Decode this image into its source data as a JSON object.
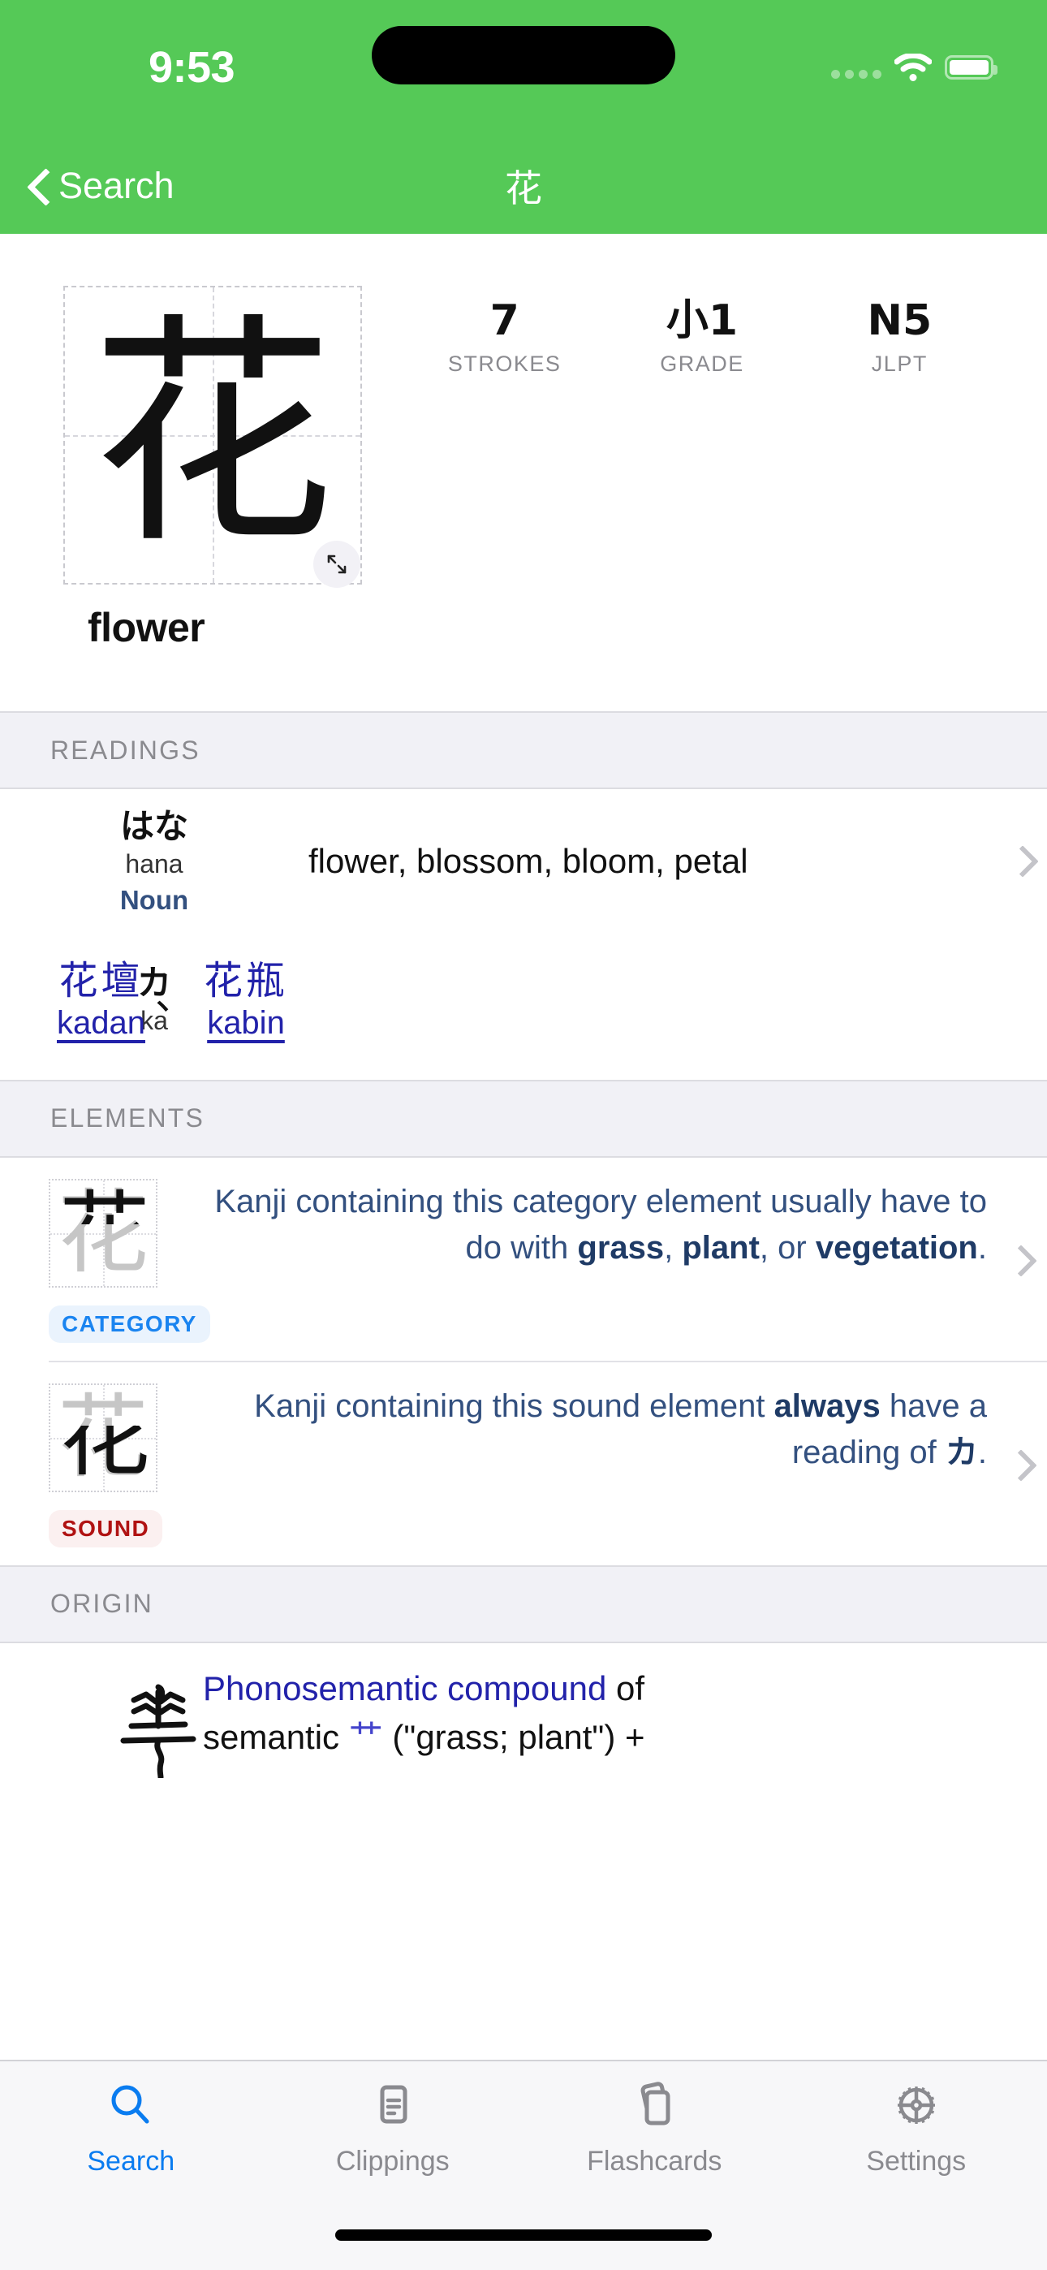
{
  "status_bar": {
    "time": "9:53",
    "icons": [
      "cellular-dots-icon",
      "wifi-icon",
      "battery-icon"
    ]
  },
  "nav": {
    "back_label": "Search",
    "back_icon": "chevron-left-icon",
    "title": "花"
  },
  "hero": {
    "kanji": "花",
    "meaning": "flower",
    "expand_icon": "expand-arrows-icon",
    "stats": [
      {
        "value": "7",
        "label": "STROKES"
      },
      {
        "value": "小1",
        "label": "GRADE"
      },
      {
        "value": "N5",
        "label": "JLPT"
      }
    ]
  },
  "readings": {
    "section_title": "READINGS",
    "rows": [
      {
        "kana": "はな",
        "romaji": "hana",
        "pos": "Noun",
        "gloss": "flower, blossom, bloom, petal",
        "chevron": "chevron-right-icon"
      },
      {
        "kana": "カ",
        "romaji": "ka",
        "separator": "、",
        "words": [
          {
            "jp": "花壇",
            "romaji": "kadan"
          },
          {
            "jp": "花瓶",
            "romaji": "kabin"
          }
        ]
      }
    ]
  },
  "elements": {
    "section_title": "ELEMENTS",
    "rows": [
      {
        "glyph": "花",
        "badge": "CATEGORY",
        "text_parts": [
          {
            "t": "Kanji containing this category element usually have to do with ",
            "bold": false
          },
          {
            "t": "grass",
            "bold": true
          },
          {
            "t": ", ",
            "bold": false
          },
          {
            "t": "plant",
            "bold": true
          },
          {
            "t": ", or ",
            "bold": false
          },
          {
            "t": "vegetation",
            "bold": true
          },
          {
            "t": ".",
            "bold": false
          }
        ],
        "chevron": "chevron-right-icon"
      },
      {
        "glyph": "花",
        "badge": "SOUND",
        "text_parts": [
          {
            "t": "Kanji containing this sound element ",
            "bold": false
          },
          {
            "t": "always",
            "bold": true
          },
          {
            "t": " have a reading of ",
            "bold": false
          },
          {
            "t": "カ",
            "bold": true
          },
          {
            "t": ".",
            "bold": false
          }
        ],
        "chevron": "chevron-right-icon"
      }
    ]
  },
  "origin": {
    "section_title": "ORIGIN",
    "seal_glyph": "seal-script-glyph-icon",
    "line1_link": "Phonosemantic compound",
    "line1_rest": " of",
    "line2_pre": "semantic ",
    "line2_kanji": "艹",
    "line2_post": " (\"grass; plant\") +"
  },
  "tabbar": {
    "items": [
      {
        "label": "Search",
        "icon": "search-icon",
        "active": true
      },
      {
        "label": "Clippings",
        "icon": "document-icon",
        "active": false
      },
      {
        "label": "Flashcards",
        "icon": "cards-icon",
        "active": false
      },
      {
        "label": "Settings",
        "icon": "gear-icon",
        "active": false
      }
    ]
  },
  "colors": {
    "header_green": "#55c957",
    "link_blue": "#2222aa",
    "element_blue": "#33507f",
    "accent_blue": "#0a7cf0",
    "category_badge": "#1a84f0",
    "sound_badge": "#b01212",
    "section_bg": "#f1f1f6"
  }
}
